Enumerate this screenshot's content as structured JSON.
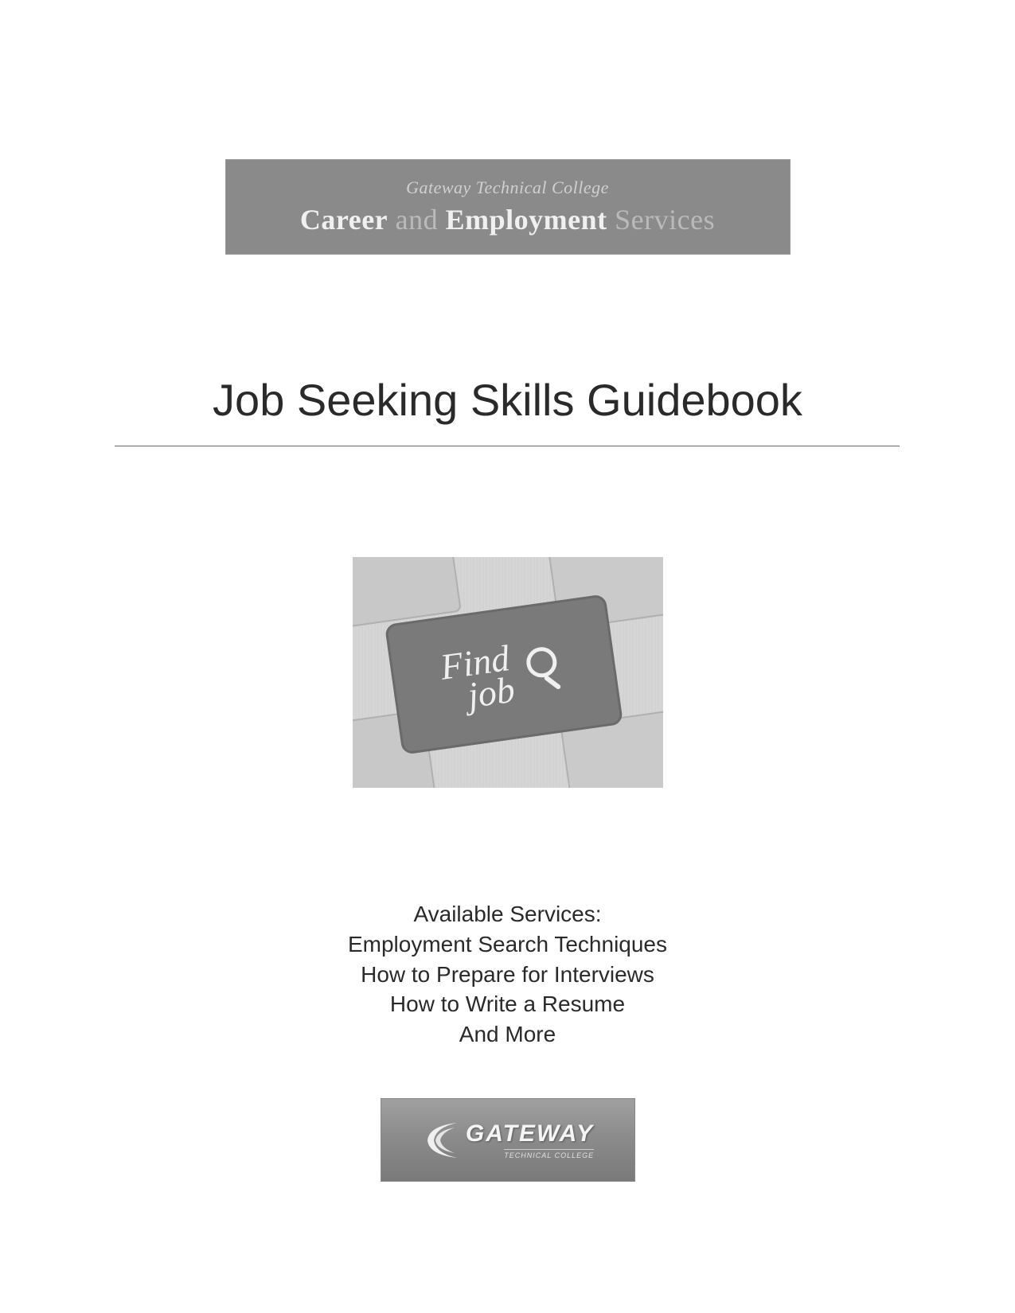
{
  "banner": {
    "top_line": "Gateway Technical College",
    "main_bold1": "Career",
    "main_light1": " and ",
    "main_bold2": "Employment",
    "main_light2": " Services"
  },
  "title": "Job Seeking Skills Guidebook",
  "keyboard": {
    "key_text_line1": "Find",
    "key_text_line2": "job",
    "icon_name": "magnifying-glass"
  },
  "services": {
    "heading": "Available Services:",
    "items": [
      "Employment Search Techniques",
      "How to Prepare for Interviews",
      "How to Write a Resume",
      "And More"
    ]
  },
  "logo": {
    "text": "GATEWAY",
    "subtext": "TECHNICAL COLLEGE"
  }
}
